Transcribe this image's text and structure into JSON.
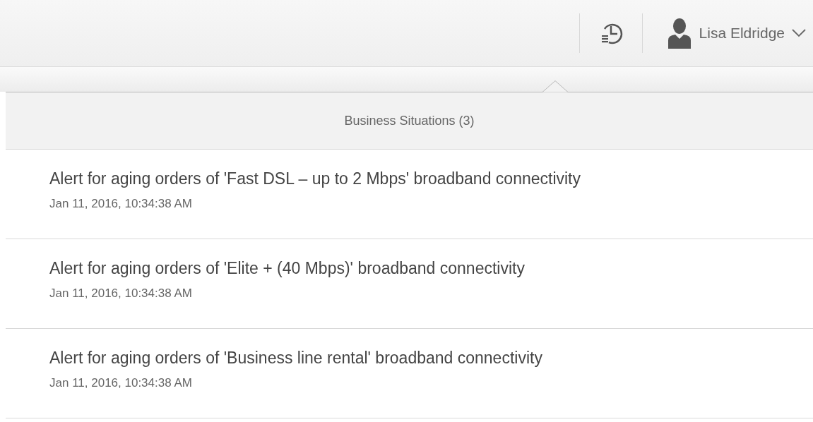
{
  "header": {
    "user_name": "Lisa Eldridge"
  },
  "popover": {
    "title": "Business Situations (3)",
    "items": [
      {
        "title": "Alert for aging orders of 'Fast DSL – up to 2 Mbps' broadband connectivity",
        "time": "Jan 11, 2016, 10:34:38 AM"
      },
      {
        "title": "Alert for aging orders of 'Elite + (40 Mbps)' broadband connectivity",
        "time": "Jan 11, 2016, 10:34:38 AM"
      },
      {
        "title": "Alert for aging orders of 'Business line rental' broadband connectivity",
        "time": "Jan 11, 2016, 10:34:38 AM"
      }
    ]
  }
}
